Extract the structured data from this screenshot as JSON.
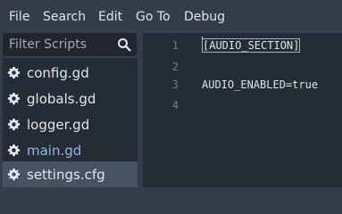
{
  "menubar": {
    "items": [
      "File",
      "Search",
      "Edit",
      "Go To",
      "Debug"
    ]
  },
  "scripts_panel": {
    "filter_placeholder": "Filter Scripts",
    "files": [
      {
        "name": "config.gd",
        "icon": "gear-icon"
      },
      {
        "name": "globals.gd",
        "icon": "gear-icon"
      },
      {
        "name": "logger.gd",
        "icon": "gear-icon"
      },
      {
        "name": "main.gd",
        "icon": "gear-icon"
      },
      {
        "name": "settings.cfg",
        "icon": "gear-icon"
      }
    ],
    "selected_index": 4,
    "current_index": 3
  },
  "editor": {
    "line_numbers": [
      "1",
      "2",
      "3",
      "4"
    ],
    "lines": [
      "[AUDIO_SECTION]",
      "",
      "AUDIO_ENABLED=true",
      ""
    ]
  },
  "colors": {
    "background": "#363d4a",
    "editor_background": "#262c36",
    "selected_item": "#465164",
    "current_script_text": "#8fb7e8"
  }
}
